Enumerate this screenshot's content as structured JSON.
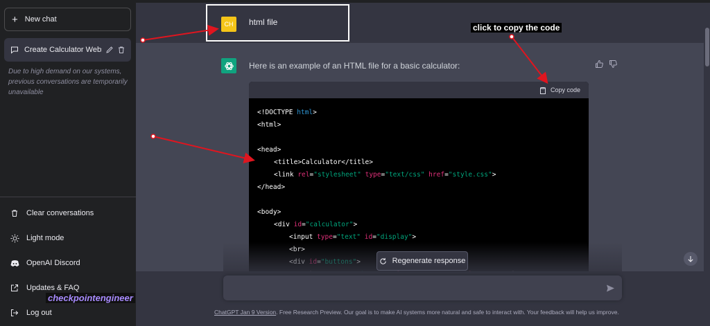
{
  "sidebar": {
    "new_chat": "New chat",
    "conversations": [
      {
        "title": "Create Calculator Websi"
      }
    ],
    "notice": "Due to high demand on our systems, previous conversations are temporarily unavailable",
    "bottom_links": [
      {
        "label": "Clear conversations",
        "icon": "trash-icon"
      },
      {
        "label": "Light mode",
        "icon": "sun-icon"
      },
      {
        "label": "OpenAI Discord",
        "icon": "discord-icon"
      },
      {
        "label": "Updates & FAQ",
        "icon": "external-link-icon"
      },
      {
        "label": "Log out",
        "icon": "logout-icon"
      }
    ]
  },
  "chat": {
    "user_avatar": "CH",
    "user_message": "html file",
    "bot_message": "Here is an example of an HTML file for a basic calculator:",
    "copy_code": "Copy code",
    "regenerate": "Regenerate response"
  },
  "footer": {
    "version_link": "ChatGPT Jan 9 Version",
    "text": ". Free Research Preview. Our goal is to make AI systems more natural and safe to interact with. Your feedback will help us improve."
  },
  "annotations": {
    "copy_hint": "click to copy the code",
    "watermark": "checkpointengineer"
  },
  "colors": {
    "sidebar_bg": "#202123",
    "main_bg": "#343541",
    "bot_bg": "#444654",
    "accent_green": "#10a37f",
    "user_avatar": "#f5c518",
    "arrow_red": "#e0151f"
  }
}
